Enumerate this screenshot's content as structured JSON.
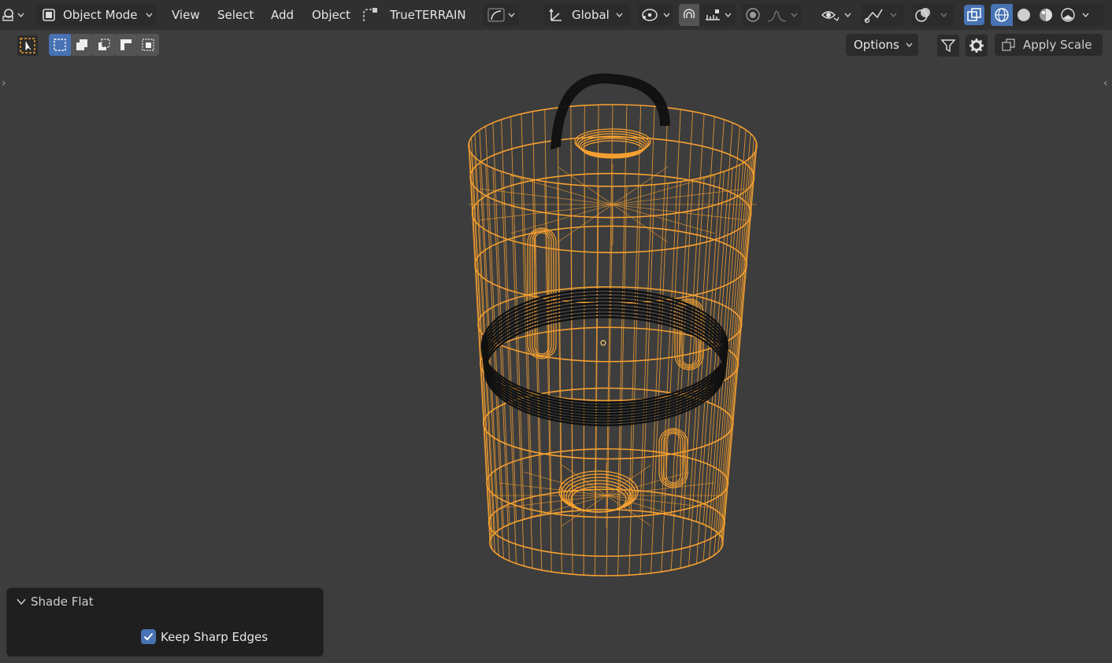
{
  "header": {
    "editor_type_icon": "viewport-editor-icon",
    "mode_label": "Object Mode",
    "menus": [
      "View",
      "Select",
      "Add",
      "Object"
    ],
    "addon_label": "TrueTERRAIN",
    "transform_orientation": "Global"
  },
  "toolbar": {
    "options_label": "Options",
    "apply_scale_label": "Apply Scale"
  },
  "operator_panel": {
    "title": "Shade Flat",
    "keep_sharp_edges_label": "Keep Sharp Edges",
    "keep_sharp_edges_checked": true
  },
  "colors": {
    "selected_wire": "#f5a030",
    "unselected_wire": "#101010",
    "accent_blue": "#4772b3",
    "viewport_bg": "#3d3d3d"
  }
}
